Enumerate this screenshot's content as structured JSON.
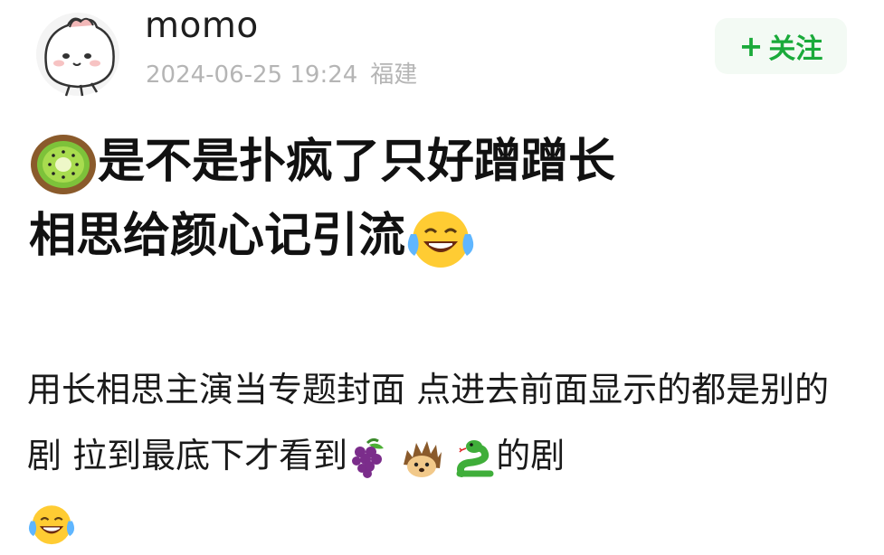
{
  "post": {
    "username": "momo",
    "timestamp": "2024-06-25 19:24",
    "location": "福建",
    "follow_label": "关注",
    "follow_plus": "+",
    "title_line1": "是不是扑疯了只好蹭蹭长",
    "title_line2": "相思给颜心记引流",
    "body_part1": "用长相思主演当专题封面 点进去前面显示的都是别的剧 拉到最底下才看到",
    "body_part2": "的剧"
  },
  "emoji_names": [
    "kiwi-emoji",
    "laughing-tears-emoji",
    "grapes-emoji",
    "hedgehog-emoji",
    "snake-emoji",
    "laughing-tears-emoji"
  ],
  "colors": {
    "follow_text": "#1aaa3a",
    "follow_bg": "#f3faf4",
    "meta_text": "#b5b5b5",
    "title_text": "#111111"
  }
}
